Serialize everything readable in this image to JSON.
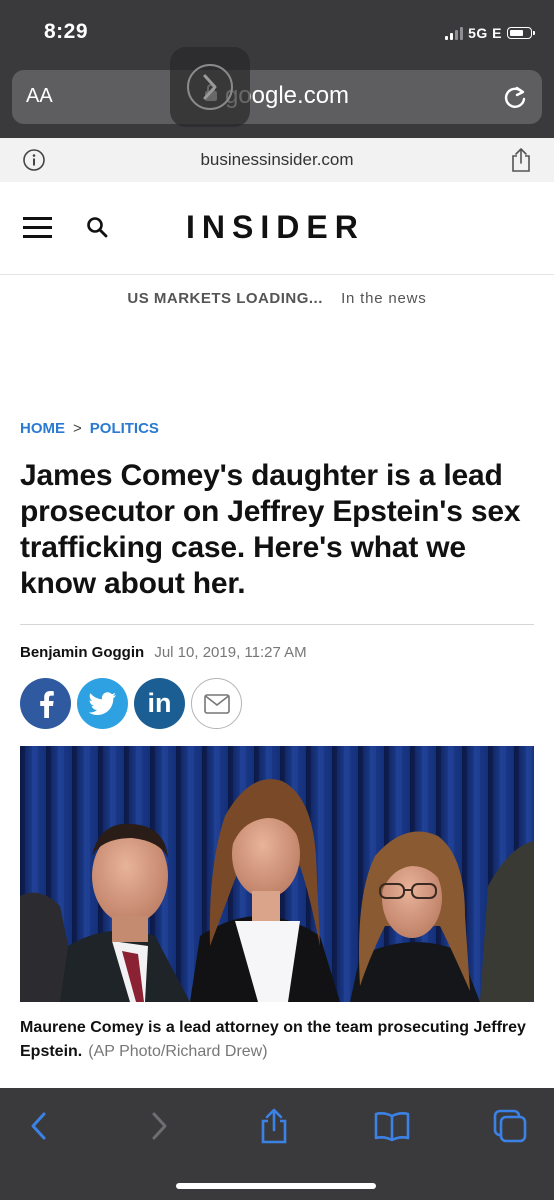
{
  "status_bar": {
    "time": "8:29",
    "network": "5G E"
  },
  "browser": {
    "text_size_label": "AA",
    "url": "google.com",
    "domain": "businessinsider.com"
  },
  "site": {
    "logo": "INSIDER",
    "markets_loading": "US MARKETS LOADING...",
    "in_the_news": "In the news"
  },
  "article": {
    "breadcrumb": [
      {
        "label": "HOME"
      },
      {
        "label": "POLITICS"
      }
    ],
    "headline": "James Comey's daughter is a lead prosecutor on Jeffrey Epstein's sex trafficking case. Here's what we know about her.",
    "author": "Benjamin Goggin",
    "date": "Jul 10, 2019, 11:27 AM",
    "caption": "Maurene Comey is a lead attorney on the team prosecuting Jeffrey Epstein.",
    "credit": "(AP Photo/Richard Drew)"
  },
  "icons": {
    "social": [
      "facebook-icon",
      "twitter-icon",
      "linkedin-icon",
      "email-icon"
    ],
    "toolbar": [
      "back-icon",
      "forward-icon",
      "share-icon",
      "bookmarks-icon",
      "tabs-icon"
    ]
  },
  "colors": {
    "link_blue": "#2a7ad2",
    "facebook": "#2f5aa0",
    "twitter": "#2ea1e3",
    "linkedin": "#1a5e93",
    "toolbar_accent": "#3c82e6"
  }
}
